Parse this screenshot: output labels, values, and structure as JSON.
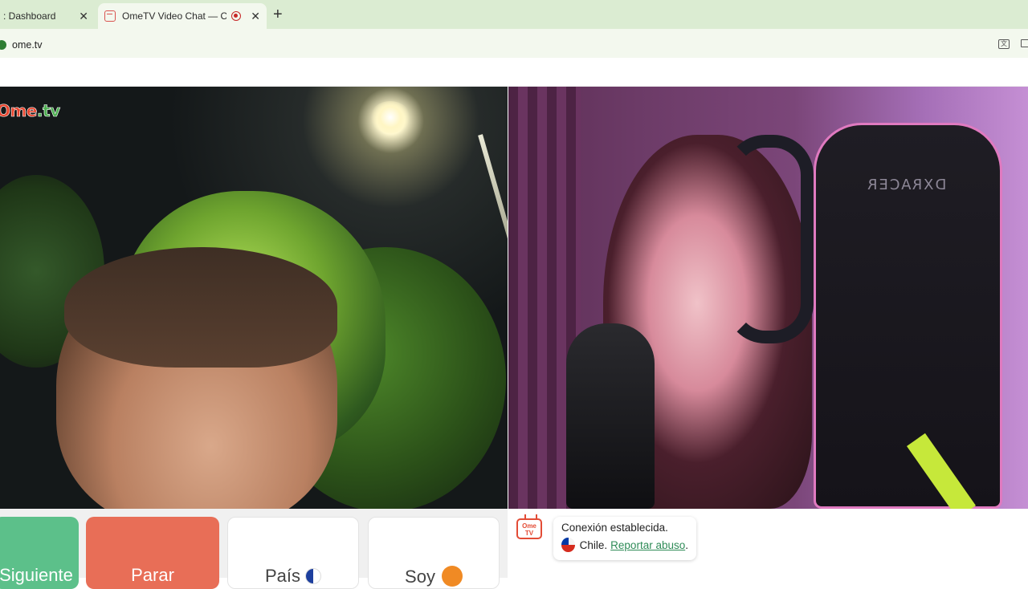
{
  "browser": {
    "tabs": [
      {
        "title": ": Dashboard",
        "active": false
      },
      {
        "title": "OmeTV Video Chat — Ome",
        "active": true,
        "recording": true
      }
    ],
    "url": "ome.tv"
  },
  "brand": {
    "logo_part1": "Ome",
    "logo_part2": ".tv",
    "colors": {
      "red": "#e8452e",
      "green": "#4caf50"
    }
  },
  "right_video": {
    "chair_brand": "DXRACER"
  },
  "controls": {
    "next_label": "Siguiente",
    "stop_label": "Parar",
    "country_label": "País",
    "gender_label": "Soy",
    "colors": {
      "next": "#5cc08a",
      "stop": "#e86e57"
    }
  },
  "chat": {
    "logo_text": "Ome TV",
    "status_text": "Conexión establecida.",
    "country": "Chile.",
    "report_link": "Reportar abuso",
    "trailing_period": "."
  }
}
